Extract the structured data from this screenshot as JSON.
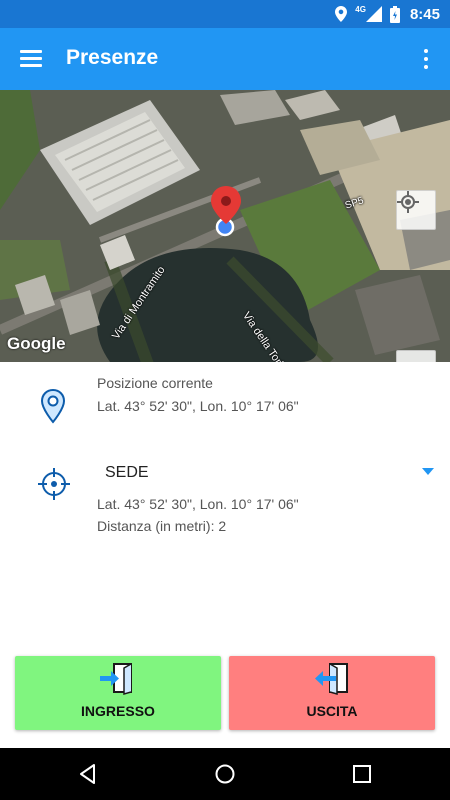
{
  "status_bar": {
    "time": "8:45",
    "network": "4G",
    "icons": [
      "location-icon",
      "signal-icon",
      "battery-icon"
    ]
  },
  "app_bar": {
    "title": "Presenze",
    "icons": [
      "menu-icon",
      "more-vert-icon"
    ]
  },
  "map": {
    "labels": {
      "montramito": "Via di Montramito",
      "torbiera": "Via della Torbiera",
      "sp5": "SP5"
    },
    "attribution": "Google",
    "zoom_in": "+",
    "zoom_out": "−",
    "icons": [
      "my-location-icon",
      "map-marker-icon",
      "current-location-dot-icon"
    ]
  },
  "current_position": {
    "title": "Posizione corrente",
    "coords": "Lat. 43° 52' 30\", Lon. 10° 17' 06\"",
    "icon": "location-pin-icon"
  },
  "site": {
    "selected": "SEDE",
    "coords": "Lat. 43° 52' 30\", Lon. 10° 17' 06\"",
    "distance": "Distanza (in metri): 2",
    "icon": "crosshair-target-icon"
  },
  "actions": {
    "in_label": "INGRESSO",
    "out_label": "USCITA",
    "in_color": "#80f57f",
    "out_color": "#ff7f7f"
  },
  "colors": {
    "status_bar": "#1976d2",
    "app_bar": "#2196f3",
    "accent": "#2196f3",
    "marker": "#e53935"
  },
  "nav_bar": {
    "icons": [
      "back-icon",
      "home-icon",
      "recents-icon"
    ]
  }
}
